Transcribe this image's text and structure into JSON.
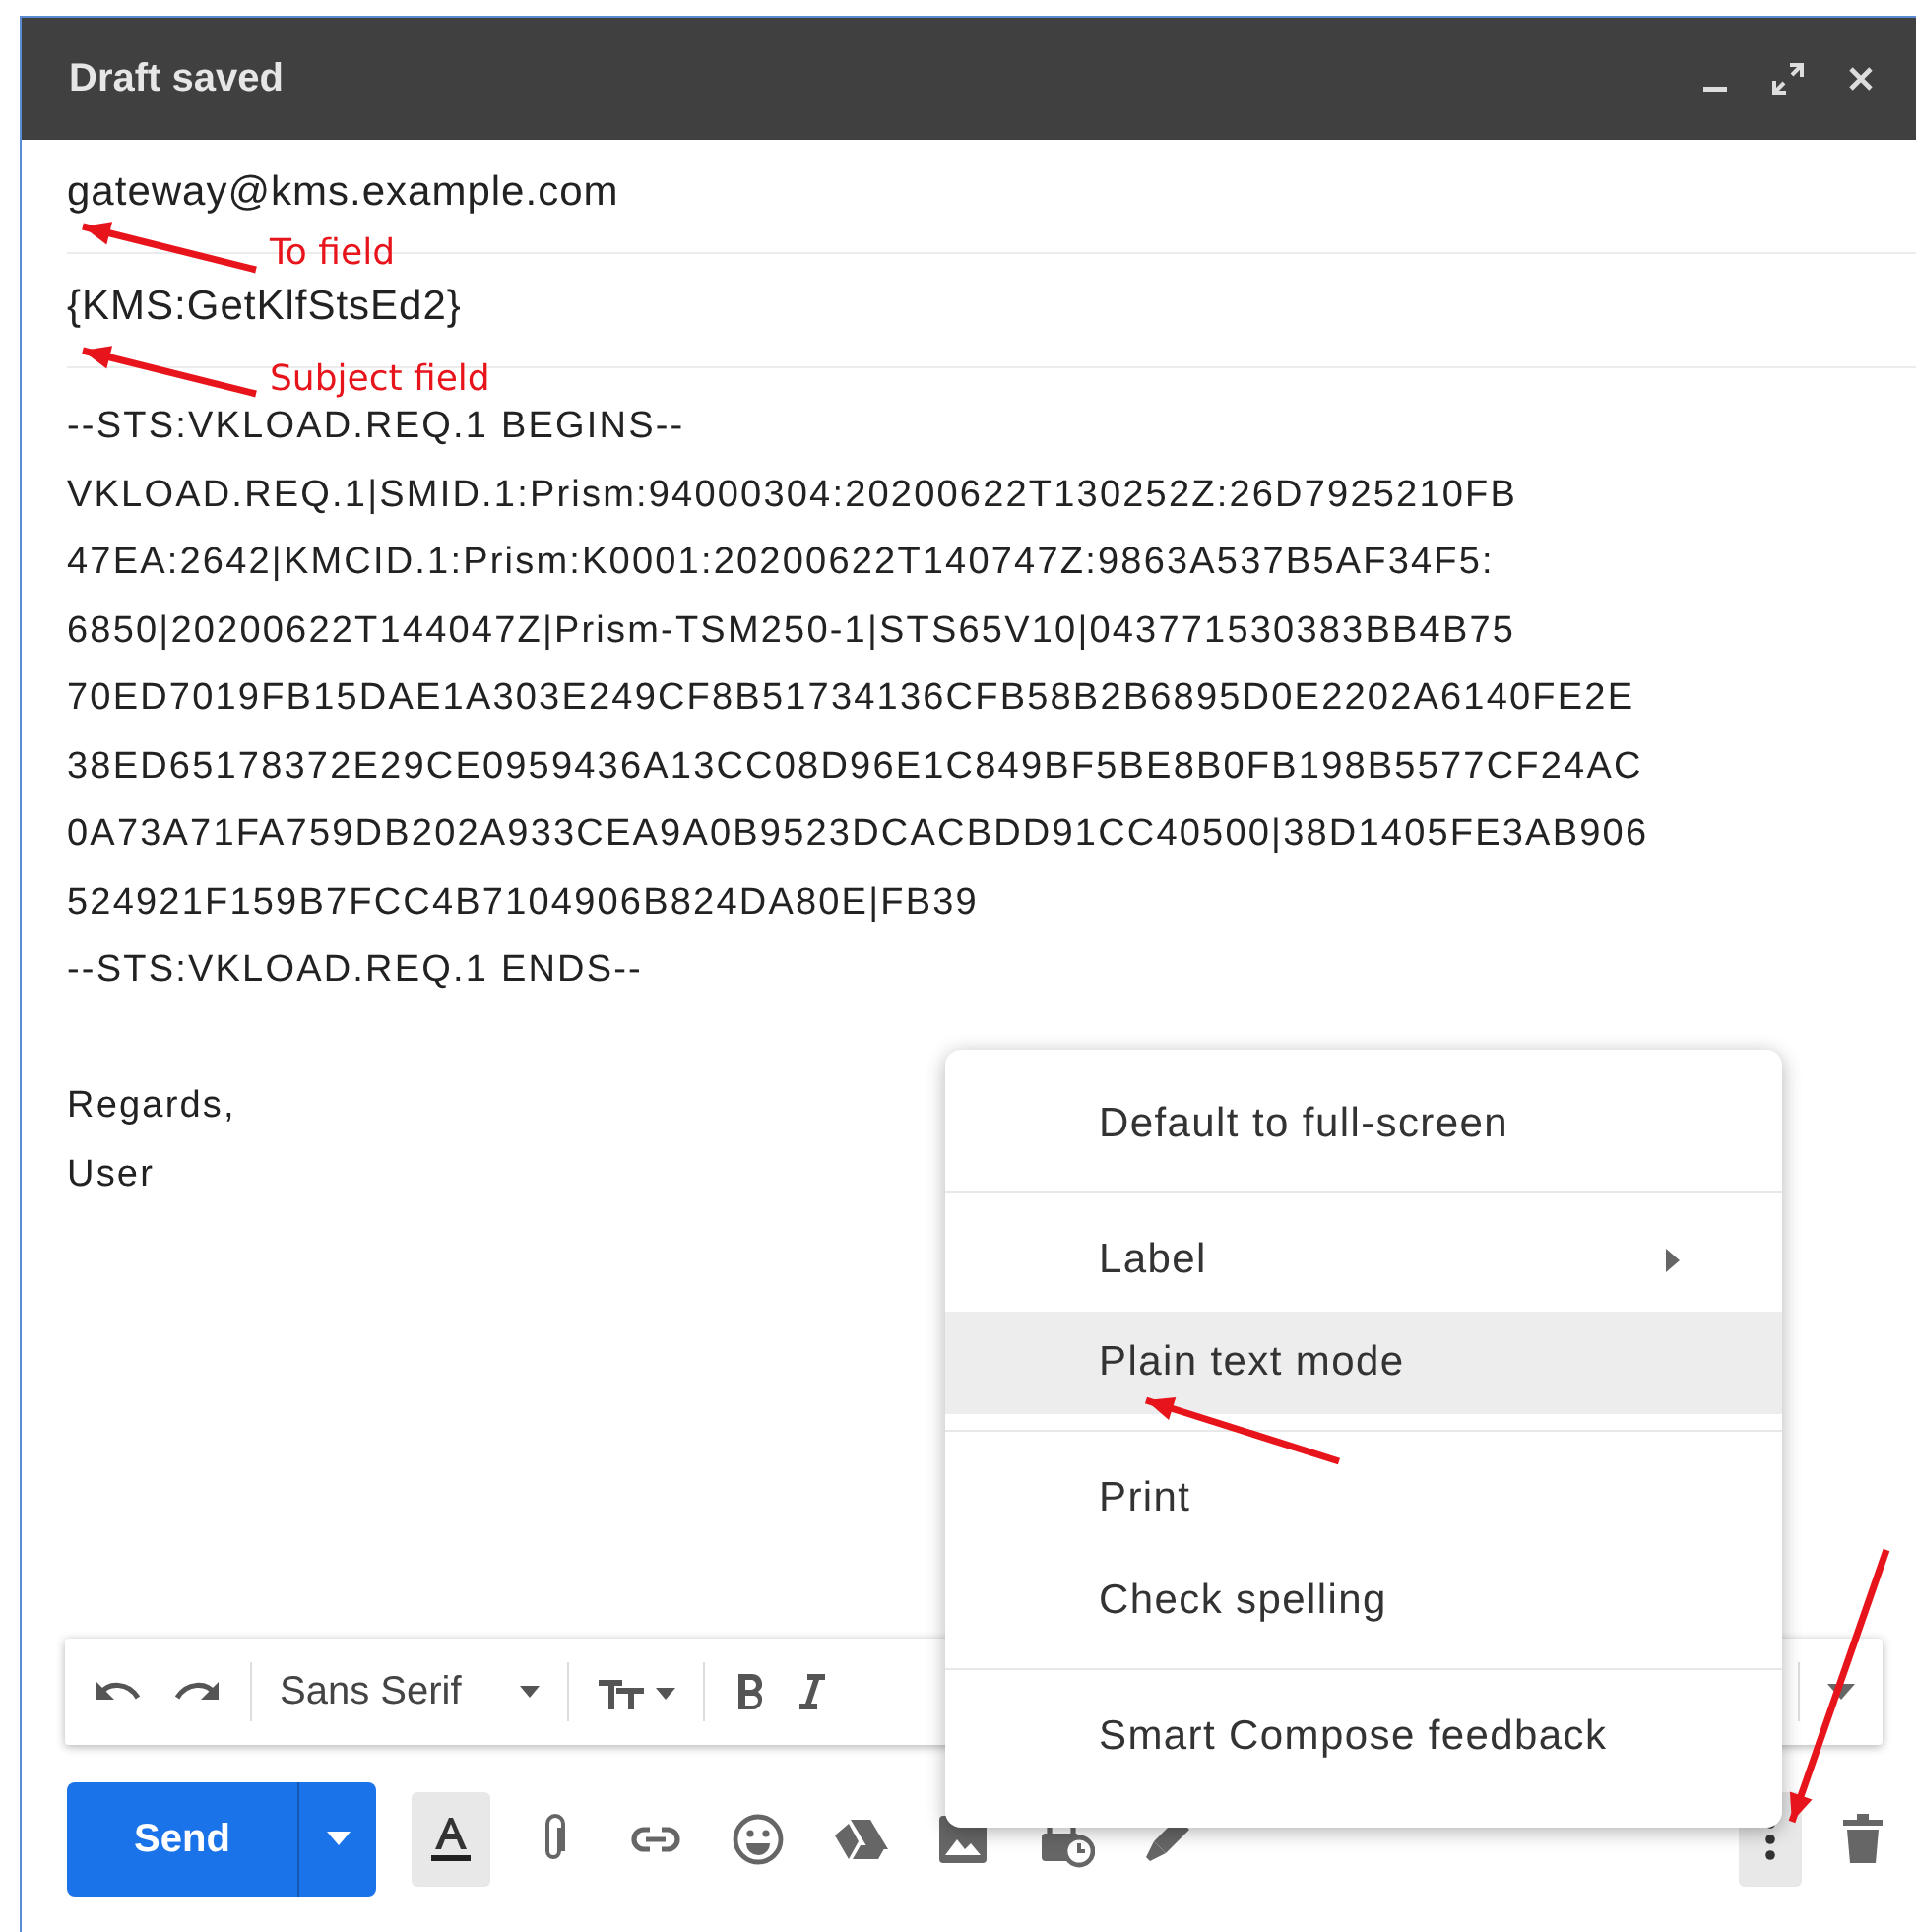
{
  "window": {
    "title": "Draft saved"
  },
  "to_field": {
    "value": "gateway@kms.example.com"
  },
  "subject_field": {
    "value": "{KMS:GetKlfStsEd2}"
  },
  "body_lines": [
    "--STS:VKLOAD.REQ.1 BEGINS--",
    "VKLOAD.REQ.1|SMID.1:Prism:94000304:20200622T130252Z:26D7925210FB",
    "47EA:2642|KMCID.1:Prism:K0001:20200622T140747Z:9863A537B5AF34F5:",
    "6850|20200622T144047Z|Prism-TSM250-1|STS65V10|043771530383BB4B75",
    "70ED7019FB15DAE1A303E249CF8B51734136CFB58B2B6895D0E2202A6140FE2E",
    "38ED65178372E29CE0959436A13CC08D96E1C849BF5BE8B0FB198B5577CF24AC",
    "0A73A71FA759DB202A933CEA9A0B9523DCACBDD91CC40500|38D1405FE3AB906",
    "524921F159B7FCC4B7104906B824DA80E|FB39",
    "--STS:VKLOAD.REQ.1 ENDS--"
  ],
  "signature": [
    "Regards,",
    "User"
  ],
  "format_toolbar": {
    "font": "Sans Serif"
  },
  "send_button": {
    "label": "Send"
  },
  "bottom_tools": [
    {
      "kind": "formatting",
      "selected": true
    },
    {
      "kind": "attach",
      "selected": false
    },
    {
      "kind": "link",
      "selected": false
    },
    {
      "kind": "emoji",
      "selected": false
    },
    {
      "kind": "drive",
      "selected": false
    },
    {
      "kind": "photo",
      "selected": false
    },
    {
      "kind": "confidential",
      "selected": false
    },
    {
      "kind": "signature",
      "selected": false
    }
  ],
  "more_button": {
    "selected": true
  },
  "menu": {
    "sections": [
      [
        {
          "label": "Default to full-screen",
          "submenu": false,
          "selected": false
        }
      ],
      [
        {
          "label": "Label",
          "submenu": true,
          "selected": false
        },
        {
          "label": "Plain text mode",
          "submenu": false,
          "selected": true
        }
      ],
      [
        {
          "label": "Print",
          "submenu": false,
          "selected": false
        },
        {
          "label": "Check spelling",
          "submenu": false,
          "selected": false
        }
      ],
      [
        {
          "label": "Smart Compose feedback",
          "submenu": false,
          "selected": false
        }
      ]
    ]
  },
  "annotations": [
    {
      "kind": "to",
      "text": "To field"
    },
    {
      "kind": "subject",
      "text": "Subject field"
    },
    {
      "kind": "menu"
    },
    {
      "kind": "more"
    }
  ]
}
